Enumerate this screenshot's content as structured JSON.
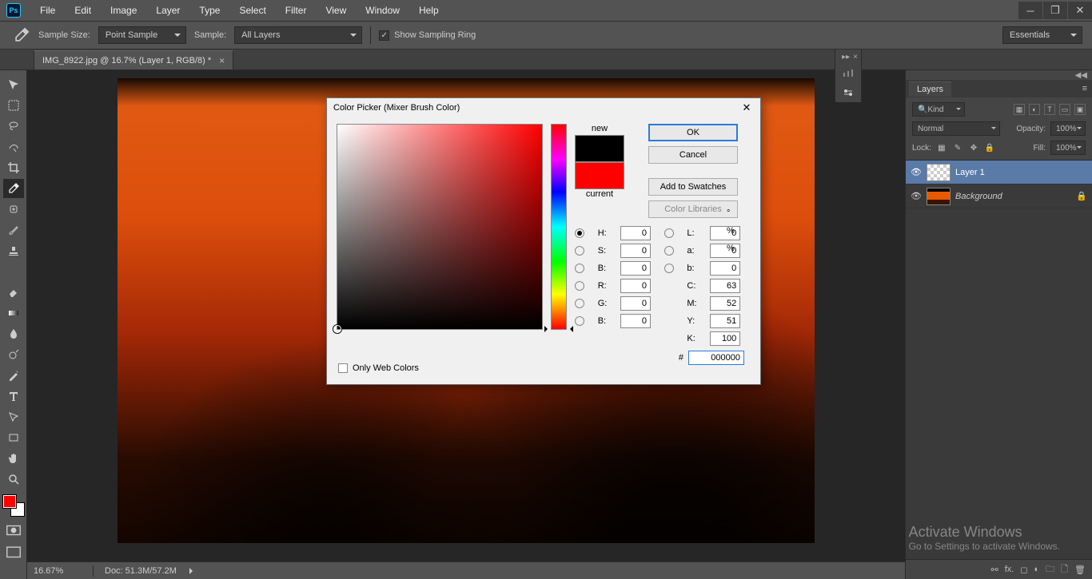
{
  "menubar": [
    "File",
    "Edit",
    "Image",
    "Layer",
    "Type",
    "Select",
    "Filter",
    "View",
    "Window",
    "Help"
  ],
  "options": {
    "sample_size_label": "Sample Size:",
    "sample_size_value": "Point Sample",
    "sample_label": "Sample:",
    "sample_value": "All Layers",
    "show_ring": "Show Sampling Ring",
    "workspace": "Essentials"
  },
  "doc_tab": "IMG_8922.jpg @ 16.7% (Layer 1, RGB/8) *",
  "status": {
    "zoom": "16.67%",
    "docsize": "Doc: 51.3M/57.2M"
  },
  "layers_panel": {
    "title": "Layers",
    "kind": "Kind",
    "blend": "Normal",
    "opacity_label": "Opacity:",
    "opacity_value": "100%",
    "lock_label": "Lock:",
    "fill_label": "Fill:",
    "fill_value": "100%",
    "items": [
      {
        "name": "Layer 1",
        "sel": true,
        "thumb": "checker"
      },
      {
        "name": "Background",
        "sel": false,
        "thumb": "sunset",
        "locked": true,
        "italic": true
      }
    ]
  },
  "watermark": {
    "t1": "Activate Windows",
    "t2": "Go to Settings to activate Windows."
  },
  "picker": {
    "title": "Color Picker (Mixer Brush Color)",
    "new_label": "new",
    "current_label": "current",
    "btn_ok": "OK",
    "btn_cancel": "Cancel",
    "btn_add": "Add to Swatches",
    "btn_libs": "Color Libraries",
    "fields": {
      "H": "0",
      "S": "0",
      "B": "0",
      "R": "0",
      "G": "0",
      "B2": "0",
      "L": "0",
      "a": "0",
      "b": "0",
      "C": "63",
      "M": "52",
      "Y": "51",
      "K": "100",
      "hex": "000000"
    },
    "deg": "°",
    "pct": "%",
    "hash": "#",
    "owc": "Only Web Colors"
  }
}
